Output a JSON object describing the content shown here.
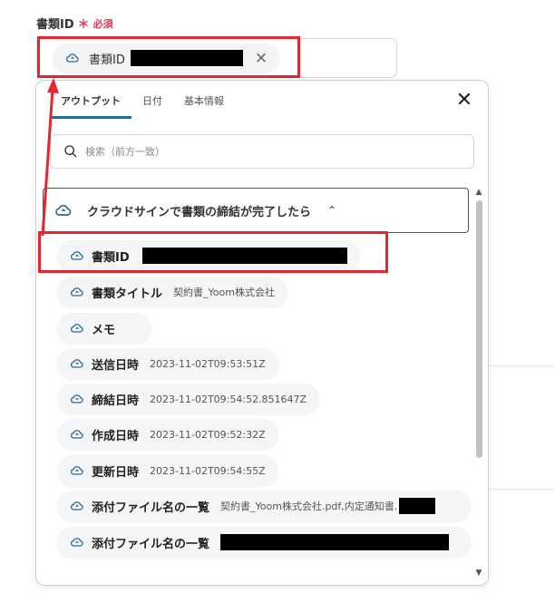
{
  "field": {
    "label": "書類ID",
    "required_mark": "＊",
    "required_text": "必須",
    "chip_label": "書類ID",
    "chip_remove": "×"
  },
  "panel": {
    "tabs": [
      {
        "label": "アウトプット",
        "active": true
      },
      {
        "label": "日付",
        "active": false
      },
      {
        "label": "基本情報",
        "active": false
      }
    ],
    "close": "✕",
    "search_placeholder": "検索（前方一致）",
    "section_title": "クラウドサインで書類の締結が完了したら",
    "section_chevron": "⌃",
    "items": [
      {
        "label": "書類ID",
        "value": ""
      },
      {
        "label": "書類タイトル",
        "value": "契約書_Yoom株式会社"
      },
      {
        "label": "メモ",
        "value": ""
      },
      {
        "label": "送信日時",
        "value": "2023-11-02T09:53:51Z"
      },
      {
        "label": "締結日時",
        "value": "2023-11-02T09:54:52.851647Z"
      },
      {
        "label": "作成日時",
        "value": "2023-11-02T09:52:32Z"
      },
      {
        "label": "更新日時",
        "value": "2023-11-02T09:54:55Z"
      },
      {
        "label": "添付ファイル名の一覧",
        "value": "契約書_Yoom株式会社.pdf,内定通知書."
      },
      {
        "label": "添付ファイル名の一覧",
        "value": ""
      }
    ],
    "scroll_up": "▲",
    "scroll_down": "▼"
  },
  "colors": {
    "accent": "#2d6a93",
    "required": "#e03a5a",
    "highlight": "#e3262f"
  }
}
